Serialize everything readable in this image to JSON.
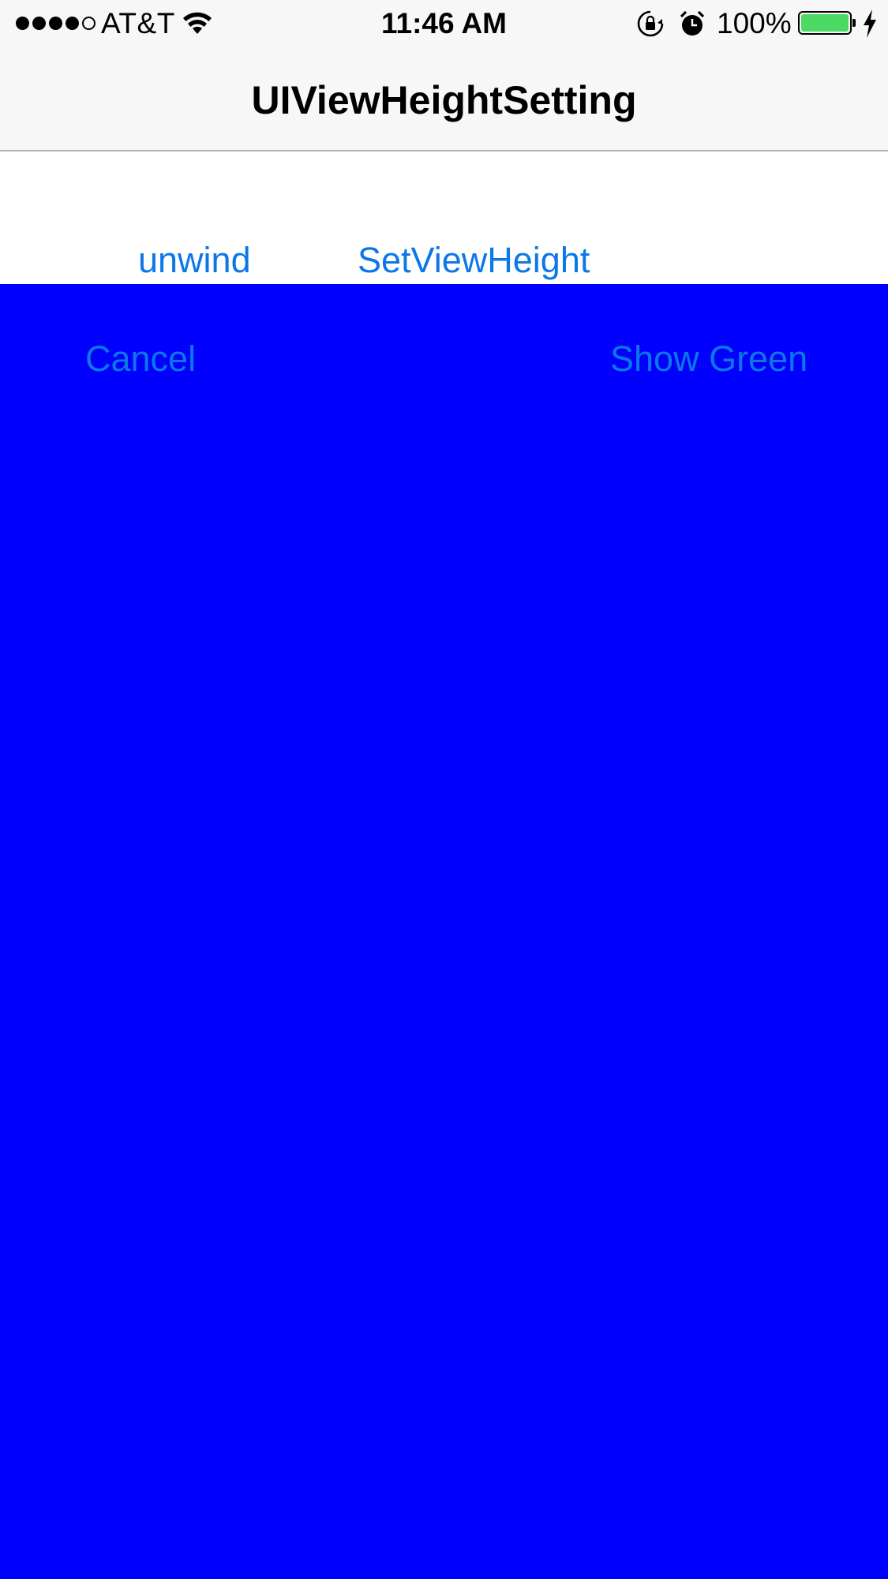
{
  "status_bar": {
    "signal_bars_filled": 4,
    "signal_bars_total": 5,
    "carrier": "AT&T",
    "time": "11:46 AM",
    "battery_percent": "100%",
    "battery_level": 1.0,
    "icons": [
      "wifi-icon",
      "rotation-lock-icon",
      "alarm-icon",
      "battery-icon",
      "charging-bolt-icon"
    ]
  },
  "nav": {
    "title": "UIViewHeightSetting"
  },
  "content": {
    "unwind_label": "unwind",
    "set_view_height_label": "SetViewHeight"
  },
  "blue_panel": {
    "background": "#0000ff",
    "cancel_label": "Cancel",
    "show_green_label": "Show Green"
  },
  "colors": {
    "tint": "#0c78e8",
    "nav_background": "#f7f7f7",
    "battery_fill": "#4cd964"
  }
}
